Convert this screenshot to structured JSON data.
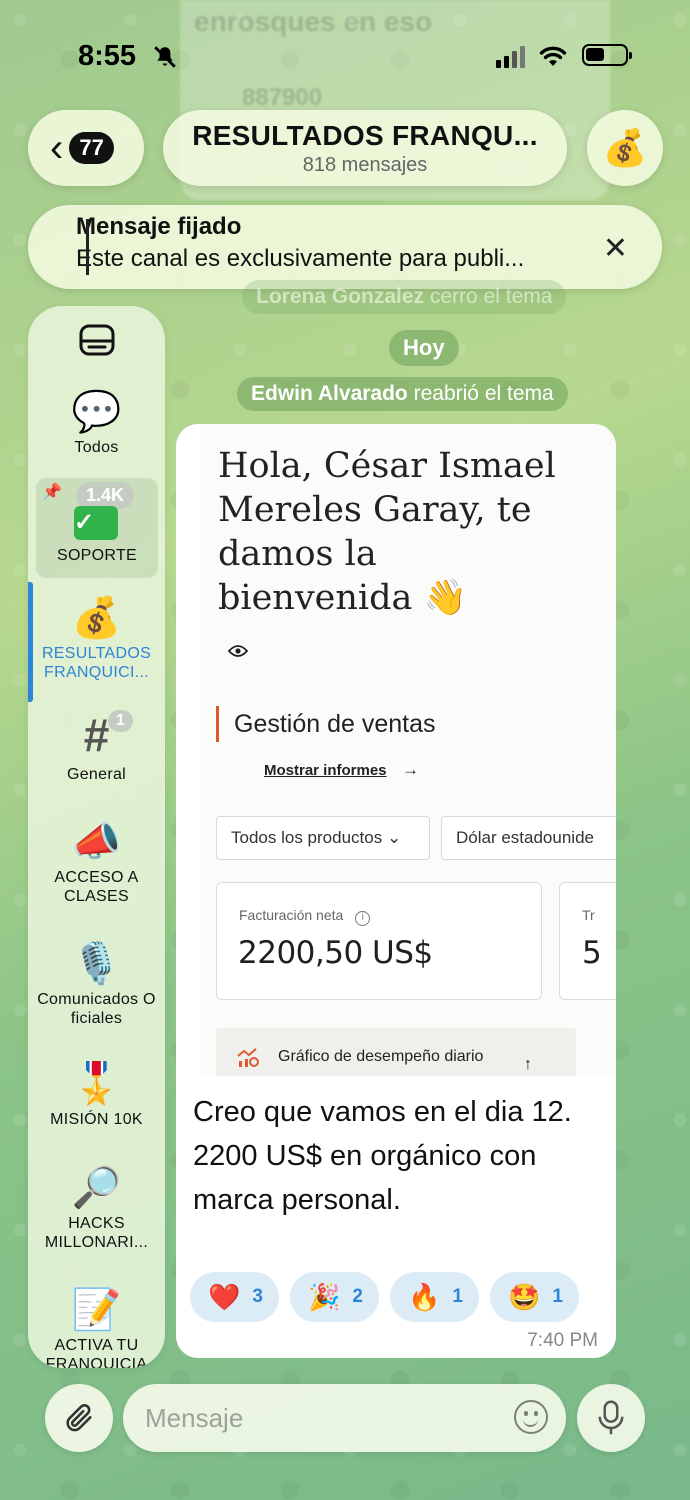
{
  "status": {
    "time": "8:55"
  },
  "header": {
    "back_count": "77",
    "title": "RESULTADOS FRANQU...",
    "subtitle": "818 mensajes",
    "avatar_icon": "money-bag"
  },
  "pinned": {
    "label": "Mensaje fijado",
    "text": "Este canal es exclusivamente para publi..."
  },
  "background_ghost": {
    "line1": "enrosques en eso",
    "line2": "887900"
  },
  "service": {
    "closed_name": "Lorena Gonzalez",
    "closed_action": "cerro el tema",
    "date": "Hoy",
    "reopened_name": "Edwin Alvarado",
    "reopened_action": "reabrió el tema"
  },
  "sidebar": {
    "items": [
      {
        "label": "Todos",
        "icon": "speech-bubbles"
      },
      {
        "label": "SOPORTE",
        "icon": "check-mark",
        "badge": "1.4K",
        "pinned": true
      },
      {
        "label": "RESULTADOS FRANQUICI...",
        "icon": "money-bag",
        "active": true
      },
      {
        "label": "General",
        "icon": "hash",
        "badge": "1"
      },
      {
        "label": "ACCESO A CLASES",
        "icon": "megaphone"
      },
      {
        "label": "Comunicados Oficiales",
        "icon": "microphone"
      },
      {
        "label": "MISIÓN 10K",
        "icon": "medal"
      },
      {
        "label": "HACKS MILLONARI...",
        "icon": "magnifier"
      },
      {
        "label": "ACTIVA TU FRANQUICIA",
        "icon": "memo"
      }
    ],
    "accent": "#2e84d6"
  },
  "message": {
    "screenshot": {
      "greeting": "Hola, César Ismael Mereles Garay, te damos la bienvenida 👋",
      "section_title": "Gestión de ventas",
      "show_reports": "Mostrar informes",
      "filter_products": "Todos los productos",
      "filter_currency": "Dólar estadounide",
      "net_revenue_label": "Facturación neta",
      "net_revenue_value": "2200,50 US$",
      "second_card_label": "Tr",
      "second_card_value": "5",
      "graph_label": "Gráfico de desempeño diario"
    },
    "text_lines": [
      "Creo que vamos en el dia 12.",
      "2200 US$ en orgánico con marca personal."
    ],
    "reactions": [
      {
        "emoji": "❤️",
        "count": "3"
      },
      {
        "emoji": "🎉",
        "count": "2"
      },
      {
        "emoji": "🔥",
        "count": "1"
      },
      {
        "emoji": "🤩",
        "count": "1"
      }
    ],
    "time": "7:40 PM"
  },
  "composer": {
    "placeholder": "Mensaje"
  }
}
